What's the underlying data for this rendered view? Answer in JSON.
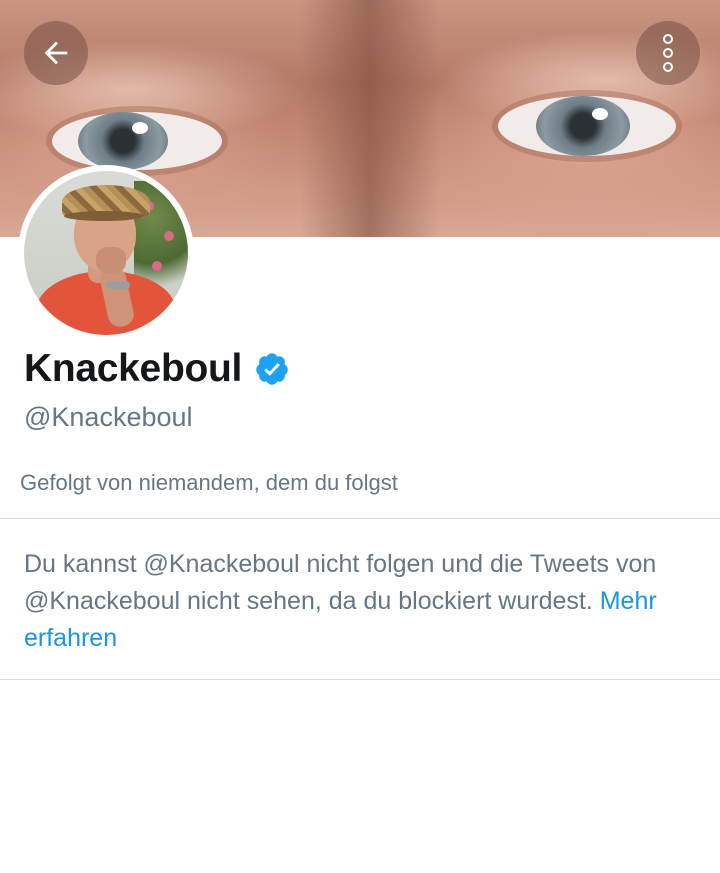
{
  "header": {
    "back_icon": "arrow-left-icon",
    "more_icon": "more-vertical-icon"
  },
  "profile": {
    "display_name": "Knackeboul",
    "verified_icon": "verified-badge-icon",
    "handle": "@Knackeboul",
    "followed_by": "Gefolgt von niemandem, dem du folgst"
  },
  "blocked_notice": {
    "text": "Du kannst @Knackeboul nicht folgen und die Tweets von @Knackeboul nicht sehen, da du blockiert wurdest.",
    "link_label": "Mehr erfahren"
  },
  "colors": {
    "accent": "#1b95e0",
    "verified": "#1da1f2",
    "name_text": "#14171a",
    "secondary_text": "#657786",
    "divider": "#cfe0e6"
  }
}
